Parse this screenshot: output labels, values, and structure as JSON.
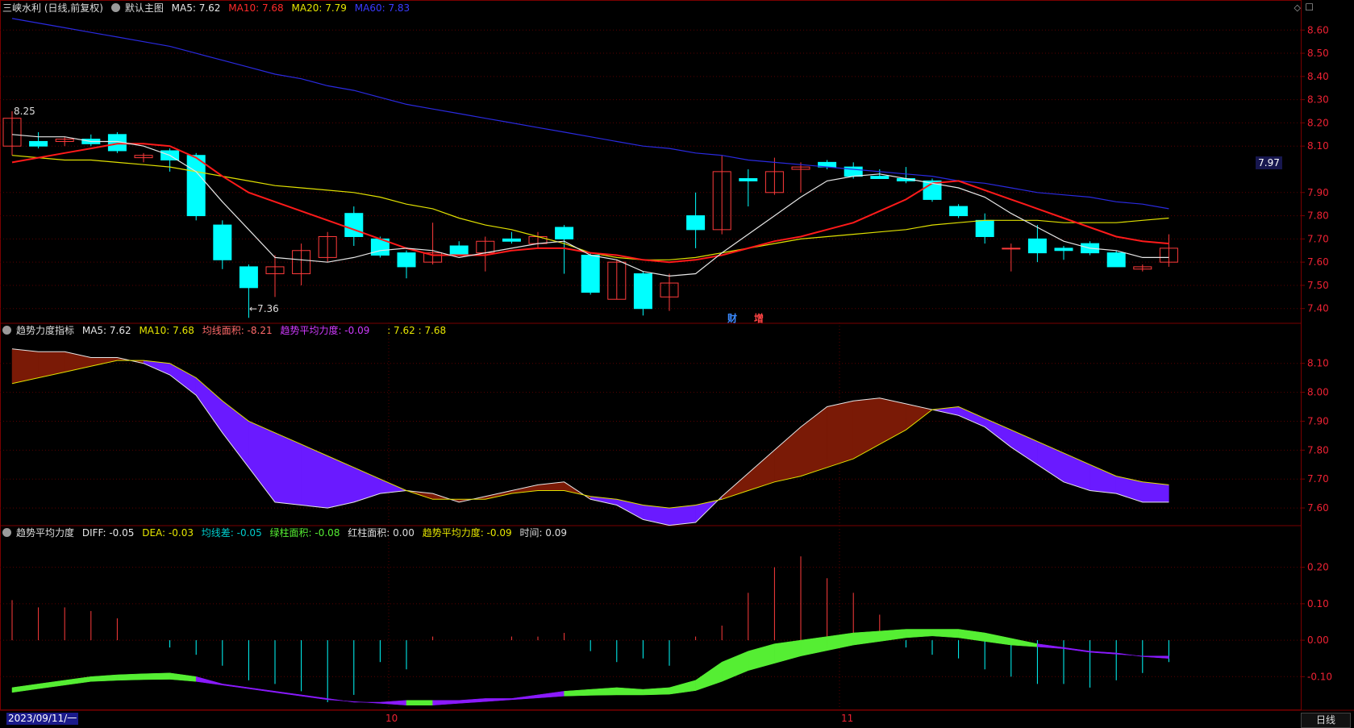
{
  "header_main": {
    "symbol": "三峡水利 (日线,前复权)",
    "template": "默认主图",
    "ma5": "MA5: 7.62",
    "ma10": "MA10: 7.68",
    "ma20": "MA20: 7.79",
    "ma60": "MA60: 7.83"
  },
  "header_ind1": {
    "name": "趋势力度指标",
    "ma5": "MA5: 7.62",
    "ma10": "MA10: 7.68",
    "area": "均线面积: -8.21",
    "force": "趋势平均力度: -0.09",
    "extra": ": 7.62 : 7.68"
  },
  "header_ind2": {
    "name": "趋势平均力度",
    "diff": "DIFF: -0.05",
    "dea": "DEA: -0.03",
    "gap": "均线差: -0.05",
    "green": "绿柱面积: -0.08",
    "red": "红柱面积: 0.00",
    "force": "趋势平均力度: -0.09",
    "time": "时间: 0.09"
  },
  "annotations": {
    "high": "8.25",
    "low": "←7.36",
    "last_price": "7.97",
    "tag1": "财",
    "tag2": "增"
  },
  "bottom": {
    "date": "2023/09/11/一",
    "month_oct": "10",
    "month_nov": "11",
    "period": "日线"
  },
  "colors": {
    "up": "#ff3b3b",
    "down": "#00ffff",
    "ma5": "#e6e6e6",
    "ma10": "#ff1a1a",
    "ma20": "#e0e000",
    "ma60": "#2a2ae0",
    "fill_up": "#7a1a06",
    "fill_down": "#6a1aff",
    "green": "#55ee33",
    "purple": "#8a1aff",
    "grid": "#7a0000"
  },
  "chart_data": {
    "type": "candlestick",
    "main": {
      "ylim": [
        7.34,
        8.66
      ],
      "yticks": [
        "8.60",
        "8.50",
        "8.40",
        "8.30",
        "8.20",
        "8.10",
        "7.90",
        "7.80",
        "7.70",
        "7.60",
        "7.50",
        "7.40"
      ],
      "ohlc": [
        [
          8.1,
          8.25,
          8.06,
          8.22
        ],
        [
          8.12,
          8.16,
          8.09,
          8.1
        ],
        [
          8.12,
          8.14,
          8.1,
          8.13
        ],
        [
          8.13,
          8.15,
          8.1,
          8.11
        ],
        [
          8.15,
          8.16,
          8.07,
          8.08
        ],
        [
          8.05,
          8.07,
          8.03,
          8.06
        ],
        [
          8.08,
          8.09,
          7.99,
          8.04
        ],
        [
          8.06,
          8.07,
          7.78,
          7.8
        ],
        [
          7.76,
          7.78,
          7.57,
          7.61
        ],
        [
          7.58,
          7.59,
          7.36,
          7.49
        ],
        [
          7.55,
          7.63,
          7.45,
          7.58
        ],
        [
          7.55,
          7.68,
          7.5,
          7.65
        ],
        [
          7.62,
          7.73,
          7.6,
          7.71
        ],
        [
          7.81,
          7.84,
          7.67,
          7.71
        ],
        [
          7.7,
          7.71,
          7.62,
          7.63
        ],
        [
          7.64,
          7.65,
          7.53,
          7.58
        ],
        [
          7.6,
          7.77,
          7.59,
          7.64
        ],
        [
          7.67,
          7.69,
          7.63,
          7.63
        ],
        [
          7.64,
          7.71,
          7.56,
          7.69
        ],
        [
          7.7,
          7.73,
          7.68,
          7.69
        ],
        [
          7.68,
          7.73,
          7.66,
          7.71
        ],
        [
          7.75,
          7.76,
          7.55,
          7.7
        ],
        [
          7.63,
          7.64,
          7.46,
          7.47
        ],
        [
          7.44,
          7.61,
          7.44,
          7.6
        ],
        [
          7.55,
          7.56,
          7.37,
          7.4
        ],
        [
          7.45,
          7.55,
          7.39,
          7.51
        ],
        [
          7.8,
          7.9,
          7.66,
          7.74
        ],
        [
          7.74,
          8.06,
          7.72,
          7.99
        ],
        [
          7.96,
          8.0,
          7.84,
          7.95
        ],
        [
          7.9,
          8.05,
          7.89,
          7.99
        ],
        [
          8.0,
          8.03,
          7.9,
          8.01
        ],
        [
          8.03,
          8.04,
          8.0,
          8.01
        ],
        [
          8.01,
          8.03,
          7.96,
          7.97
        ],
        [
          7.97,
          8.0,
          7.96,
          7.96
        ],
        [
          7.96,
          8.01,
          7.94,
          7.95
        ],
        [
          7.95,
          7.96,
          7.86,
          7.87
        ],
        [
          7.84,
          7.85,
          7.79,
          7.8
        ],
        [
          7.78,
          7.81,
          7.68,
          7.71
        ],
        [
          7.66,
          7.68,
          7.56,
          7.66
        ],
        [
          7.7,
          7.76,
          7.6,
          7.64
        ],
        [
          7.66,
          7.67,
          7.61,
          7.65
        ],
        [
          7.68,
          7.69,
          7.63,
          7.64
        ],
        [
          7.64,
          7.65,
          7.58,
          7.58
        ],
        [
          7.57,
          7.59,
          7.56,
          7.58
        ],
        [
          7.6,
          7.72,
          7.58,
          7.66
        ]
      ],
      "ma5": [
        8.15,
        8.14,
        8.14,
        8.12,
        8.12,
        8.1,
        8.06,
        7.99,
        7.86,
        7.74,
        7.62,
        7.61,
        7.6,
        7.62,
        7.65,
        7.66,
        7.65,
        7.62,
        7.64,
        7.66,
        7.68,
        7.69,
        7.63,
        7.61,
        7.56,
        7.54,
        7.55,
        7.64,
        7.72,
        7.8,
        7.88,
        7.95,
        7.97,
        7.98,
        7.96,
        7.94,
        7.92,
        7.88,
        7.81,
        7.75,
        7.69,
        7.66,
        7.65,
        7.62,
        7.62
      ],
      "ma10": [
        8.03,
        8.05,
        8.07,
        8.09,
        8.11,
        8.11,
        8.1,
        8.05,
        7.97,
        7.9,
        7.86,
        7.82,
        7.78,
        7.74,
        7.7,
        7.66,
        7.63,
        7.63,
        7.63,
        7.65,
        7.66,
        7.66,
        7.64,
        7.63,
        7.61,
        7.6,
        7.61,
        7.63,
        7.66,
        7.69,
        7.71,
        7.74,
        7.77,
        7.82,
        7.87,
        7.94,
        7.95,
        7.91,
        7.87,
        7.83,
        7.79,
        7.75,
        7.71,
        7.69,
        7.68
      ],
      "ma20": [
        8.06,
        8.05,
        8.04,
        8.04,
        8.03,
        8.02,
        8.01,
        7.99,
        7.97,
        7.95,
        7.93,
        7.92,
        7.91,
        7.9,
        7.88,
        7.85,
        7.83,
        7.79,
        7.76,
        7.74,
        7.71,
        7.68,
        7.64,
        7.62,
        7.61,
        7.61,
        7.62,
        7.64,
        7.66,
        7.68,
        7.7,
        7.71,
        7.72,
        7.73,
        7.74,
        7.76,
        7.77,
        7.78,
        7.78,
        7.78,
        7.77,
        7.77,
        7.77,
        7.78,
        7.79
      ],
      "ma60": [
        8.65,
        8.63,
        8.61,
        8.59,
        8.57,
        8.55,
        8.53,
        8.5,
        8.47,
        8.44,
        8.41,
        8.39,
        8.36,
        8.34,
        8.31,
        8.28,
        8.26,
        8.24,
        8.22,
        8.2,
        8.18,
        8.16,
        8.14,
        8.12,
        8.1,
        8.09,
        8.07,
        8.06,
        8.04,
        8.03,
        8.02,
        8.01,
        8.0,
        7.99,
        7.98,
        7.97,
        7.95,
        7.94,
        7.92,
        7.9,
        7.89,
        7.88,
        7.86,
        7.85,
        7.83
      ]
    },
    "ind1": {
      "ylim": [
        7.55,
        8.18
      ],
      "yticks": [
        "8.10",
        "8.00",
        "7.90",
        "7.80",
        "7.70",
        "7.60"
      ]
    },
    "ind2": {
      "ylim": [
        -0.19,
        0.27
      ],
      "yticks": [
        "0.20",
        "0.10",
        "0.00",
        "-0.10"
      ],
      "diff": [
        -0.13,
        -0.12,
        -0.11,
        -0.1,
        -0.095,
        -0.092,
        -0.09,
        -0.1,
        -0.12,
        -0.13,
        -0.14,
        -0.15,
        -0.16,
        -0.17,
        -0.17,
        -0.165,
        -0.165,
        -0.165,
        -0.16,
        -0.16,
        -0.15,
        -0.14,
        -0.135,
        -0.13,
        -0.135,
        -0.13,
        -0.11,
        -0.06,
        -0.03,
        -0.01,
        0.0,
        0.01,
        0.02,
        0.025,
        0.03,
        0.03,
        0.03,
        0.02,
        0.005,
        -0.01,
        -0.02,
        -0.03,
        -0.035,
        -0.045,
        -0.05
      ],
      "dea": [
        -0.13,
        -0.12,
        -0.11,
        -0.1,
        -0.097,
        -0.095,
        -0.094,
        -0.1,
        -0.11,
        -0.12,
        -0.13,
        -0.14,
        -0.15,
        -0.155,
        -0.16,
        -0.165,
        -0.165,
        -0.16,
        -0.155,
        -0.15,
        -0.145,
        -0.14,
        -0.138,
        -0.137,
        -0.137,
        -0.135,
        -0.125,
        -0.1,
        -0.07,
        -0.05,
        -0.03,
        -0.015,
        0.0,
        0.01,
        0.02,
        0.025,
        0.02,
        0.01,
        0.0,
        -0.005,
        -0.01,
        -0.02,
        -0.025,
        -0.03,
        -0.03
      ],
      "bars": [
        0.11,
        0.09,
        0.09,
        0.08,
        0.06,
        0.0,
        -0.02,
        -0.04,
        -0.07,
        -0.11,
        -0.12,
        -0.14,
        -0.17,
        -0.15,
        -0.06,
        -0.08,
        0.01,
        0.0,
        0.0,
        0.01,
        0.01,
        0.02,
        -0.03,
        -0.06,
        -0.05,
        -0.07,
        0.01,
        0.04,
        0.13,
        0.2,
        0.23,
        0.17,
        0.13,
        0.07,
        -0.02,
        -0.04,
        -0.05,
        -0.08,
        -0.1,
        -0.12,
        -0.12,
        -0.13,
        -0.11,
        -0.09,
        -0.06
      ]
    }
  }
}
